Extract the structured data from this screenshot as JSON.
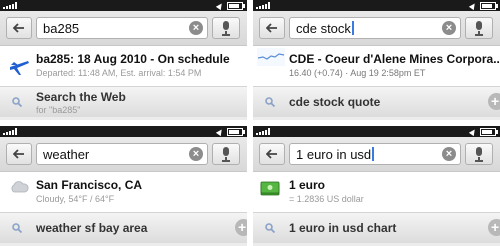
{
  "panels": [
    {
      "query": "ba285",
      "result_title": "ba285: 18 Aug 2010 - On schedule",
      "result_subtitle": "Departed: 11:48 AM, Est. arrival: 1:54 PM",
      "suggestion": "Search the Web",
      "suggestion_sub": "for \"ba285\""
    },
    {
      "query": "cde stock",
      "result_title": "CDE - Coeur d'Alene Mines Corpora...",
      "result_subtitle": "16.40 (+0.74) · Aug 19 2:58pm ET",
      "suggestion": "cde stock quote"
    },
    {
      "query": "weather",
      "result_title": "San Francisco, CA",
      "result_subtitle": "Cloudy, 54°F / 64°F",
      "suggestion": "weather sf bay area"
    },
    {
      "query": "1 euro in usd",
      "result_title": "1 euro",
      "result_subtitle": "= 1.2836 US dollar",
      "suggestion": "1 euro in usd chart"
    }
  ],
  "icons": {
    "back": "back-arrow-icon",
    "clear": "clear-icon",
    "mic": "microphone-icon",
    "suggestion": "magnifier-icon",
    "add": "plus-icon"
  },
  "colors": {
    "status_bar": "#1a1a1a",
    "caret": "#3a7be0",
    "flight_icon": "#1f5fd0",
    "money_icon": "#3c9a2c"
  }
}
